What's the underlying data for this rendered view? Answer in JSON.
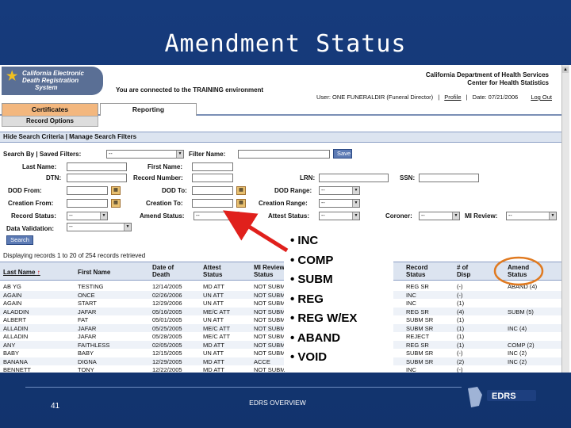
{
  "slide": {
    "title": "Amendment Status",
    "page_number": "41",
    "footer": "EDRS OVERVIEW",
    "logo_text": "EDRS"
  },
  "app": {
    "logo_lines": [
      "California Electronic",
      "Death Registration",
      "System"
    ],
    "environment_notice": "You are connected to the TRAINING environment",
    "department": [
      "California Department of Health Services",
      "Center for Health Statistics"
    ],
    "user_line": {
      "user": "User: ONE FUNERALDIR (Funeral Director)",
      "profile": "Profile",
      "date": "Date: 07/21/2006",
      "logout": "Log Out"
    },
    "tabs": [
      "Certificates",
      "Reporting"
    ],
    "subtab": "Record Options",
    "search_bar": "Hide Search Criteria | Manage Search Filters"
  },
  "search": {
    "search_by_label": "Search By | Saved Filters:",
    "saved_filter_value": "--",
    "filter_name_label": "Filter Name:",
    "save_button": "Save",
    "last_name_label": "Last Name:",
    "first_name_label": "First Name:",
    "dtn_label": "DTN:",
    "record_number_label": "Record Number:",
    "lrn_label": "LRN:",
    "ssn_label": "SSN:",
    "dod_from_label": "DOD From:",
    "dod_to_label": "DOD To:",
    "dod_range_label": "DOD Range:",
    "dod_range_value": "--",
    "creation_from_label": "Creation From:",
    "creation_to_label": "Creation To:",
    "creation_range_label": "Creation Range:",
    "creation_range_value": "--",
    "record_status_label": "Record Status:",
    "record_status_value": "--",
    "amend_status_label": "Amend Status:",
    "amend_status_value": "--",
    "attest_status_label": "Attest Status:",
    "attest_status_value": "--",
    "coroner_label": "Coroner:",
    "coroner_value": "--",
    "mi_review_label": "MI Review:",
    "mi_review_value": "--",
    "data_validation_label": "Data Validation:",
    "data_validation_value": "--",
    "search_button": "Search"
  },
  "results": {
    "summary": "Displaying records 1 to 20 of 254 records retrieved",
    "columns": [
      "Last Name",
      "First Name",
      "Date of Death",
      "Attest Status",
      "MI Review Status",
      "",
      "",
      "",
      "",
      "Record Status",
      "# of Disp",
      "Amend Status"
    ],
    "rows": [
      [
        "AB YG",
        "TESTING",
        "12/14/2005",
        "MD ATT",
        "NOT SUBM",
        "REG SR",
        "(-)",
        "ABAND (4)"
      ],
      [
        "AGAIN",
        "ONCE",
        "02/26/2006",
        "UN ATT",
        "NOT SUBM",
        "INC",
        "(-)",
        ""
      ],
      [
        "AGAIN",
        "START",
        "12/29/2006",
        "UN ATT",
        "NOT SUBM",
        "INC",
        "(1)",
        ""
      ],
      [
        "ALADDIN",
        "JAFAR",
        "05/16/2005",
        "ME/C ATT",
        "NOT SUBM",
        "REG SR",
        "(4)",
        "SUBM (5)"
      ],
      [
        "ALBERT",
        "FAT",
        "05/01/2005",
        "UN ATT",
        "NOT SUBM",
        "SUBM SR",
        "(1)",
        ""
      ],
      [
        "ALLADIN",
        "JAFAR",
        "05/25/2005",
        "ME/C ATT",
        "NOT SUBM",
        "SUBM SR",
        "(1)",
        "INC (4)"
      ],
      [
        "ALLADIN",
        "JAFAR",
        "05/28/2005",
        "ME/C ATT",
        "NOT SUBM",
        "REJECT",
        "(1)",
        ""
      ],
      [
        "ANY",
        "FAITHLESS",
        "02/05/2005",
        "MD ATT",
        "NOT SUBM",
        "REG SR",
        "(1)",
        "COMP (2)"
      ],
      [
        "BABY",
        "BABY",
        "12/15/2005",
        "UN ATT",
        "NOT SUBM",
        "SUBM SR",
        "(-)",
        "INC (2)"
      ],
      [
        "BANANA",
        "DIGNA",
        "12/29/2005",
        "MD ATT",
        "ACCE",
        "SUBM SR",
        "(2)",
        "INC (2)"
      ],
      [
        "BENNETT",
        "TONY",
        "12/22/2005",
        "MD ATT",
        "NOT SUBM",
        "INC",
        "(-)",
        ""
      ]
    ]
  },
  "callout": {
    "items": [
      "INC",
      "COMP",
      "SUBM",
      "REG",
      "REG W/EX",
      "ABAND",
      "VOID"
    ]
  },
  "colors": {
    "slide_background": "#153a7a",
    "arrow": "#e0201c",
    "highlight_ellipse": "#e07a20",
    "certificates_tab": "#f3b77e",
    "header_bar": "#dce4f0"
  }
}
